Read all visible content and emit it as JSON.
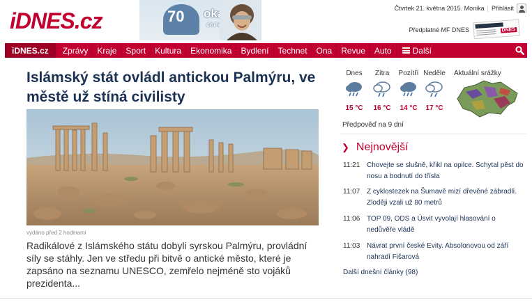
{
  "header": {
    "logo": "iDNES.cz",
    "banner": {
      "number": "70",
      "title": "okamžiků",
      "subtitle": "druhé světové války"
    },
    "date_user": "Čtvrtek 21. května 2015. Monika",
    "login": "Přihlásit",
    "subscribe": "Předplatné MF DNES",
    "newspaper_label": "DNES"
  },
  "nav": {
    "brand": "iDNES.cz",
    "items": [
      "Zprávy",
      "Kraje",
      "Sport",
      "Kultura",
      "Ekonomika",
      "Bydlení",
      "Technet",
      "Ona",
      "Revue",
      "Auto"
    ],
    "more": "Další"
  },
  "article": {
    "headline": "Islámský stát ovládl antickou Palmýru, ve městě už stíná civilisty",
    "published": "vydáno před 2 hodinami",
    "perex": "Radikálové z Islámského státu dobyli syrskou Palmýru, provládní síly se stáhly. Jen ve středu při bitvě o antické město, které je zapsáno na seznamu UNESCO, zemřelo nejméně sto vojáků prezidenta..."
  },
  "weather": {
    "days": [
      {
        "name": "Dnes",
        "temp": "15 °C",
        "icon": "rain-cloud-icon"
      },
      {
        "name": "Zítra",
        "temp": "16 °C",
        "icon": "shower-cloud-icon"
      },
      {
        "name": "Pozítří",
        "temp": "14 °C",
        "icon": "rain-cloud-icon"
      },
      {
        "name": "Neděle",
        "temp": "17 °C",
        "icon": "shower-cloud-icon"
      }
    ],
    "radar_label": "Aktuální srážky",
    "forecast_link": "Předpověď na 9 dní"
  },
  "latest": {
    "title": "Nejnovější",
    "items": [
      {
        "time": "11:21",
        "text": "Chovejte se slušně, křikl na opilce. Schytal pěst do nosu a bodnutí do tříslа"
      },
      {
        "time": "11:07",
        "text": "Z cyklostezek na Šumavě mizí dřevěné zábradlí. Zloději vzali už 80 metrů"
      },
      {
        "time": "11:06",
        "text": "TOP 09, ODS a Úsvit vyvolají hlasování o nedůvěře vládě"
      },
      {
        "time": "11:03",
        "text": "Návrat první české Evity. Absolonovou od září nahradí Fišarová"
      }
    ],
    "more": "Další dnešní články (98)"
  },
  "colors": {
    "brand_red": "#c2002f",
    "headline_blue": "#1c3254"
  }
}
